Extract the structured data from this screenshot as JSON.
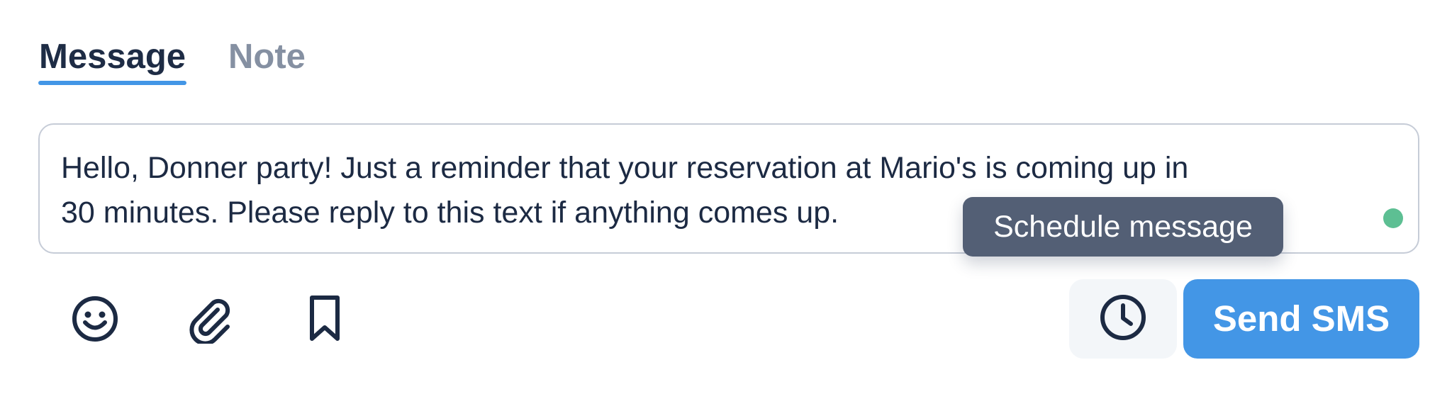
{
  "tabs": [
    {
      "label": "Message",
      "active": true
    },
    {
      "label": "Note",
      "active": false
    }
  ],
  "composer": {
    "text": "Hello, Donner party! Just a reminder that your reservation at Mario's is coming up in\n30 minutes. Please reply to this text if anything comes up.",
    "status_color": "#5dbf93"
  },
  "tooltip": {
    "text": "Schedule message"
  },
  "toolbar": {
    "icons": [
      "smiley-icon",
      "paperclip-icon",
      "bookmark-icon"
    ],
    "schedule_icon": "clock-icon"
  },
  "send_button": {
    "label": "Send SMS"
  },
  "colors": {
    "accent": "#4396e6",
    "text": "#1c2a43",
    "muted": "#8590a2",
    "tooltip_bg": "#535f75"
  }
}
